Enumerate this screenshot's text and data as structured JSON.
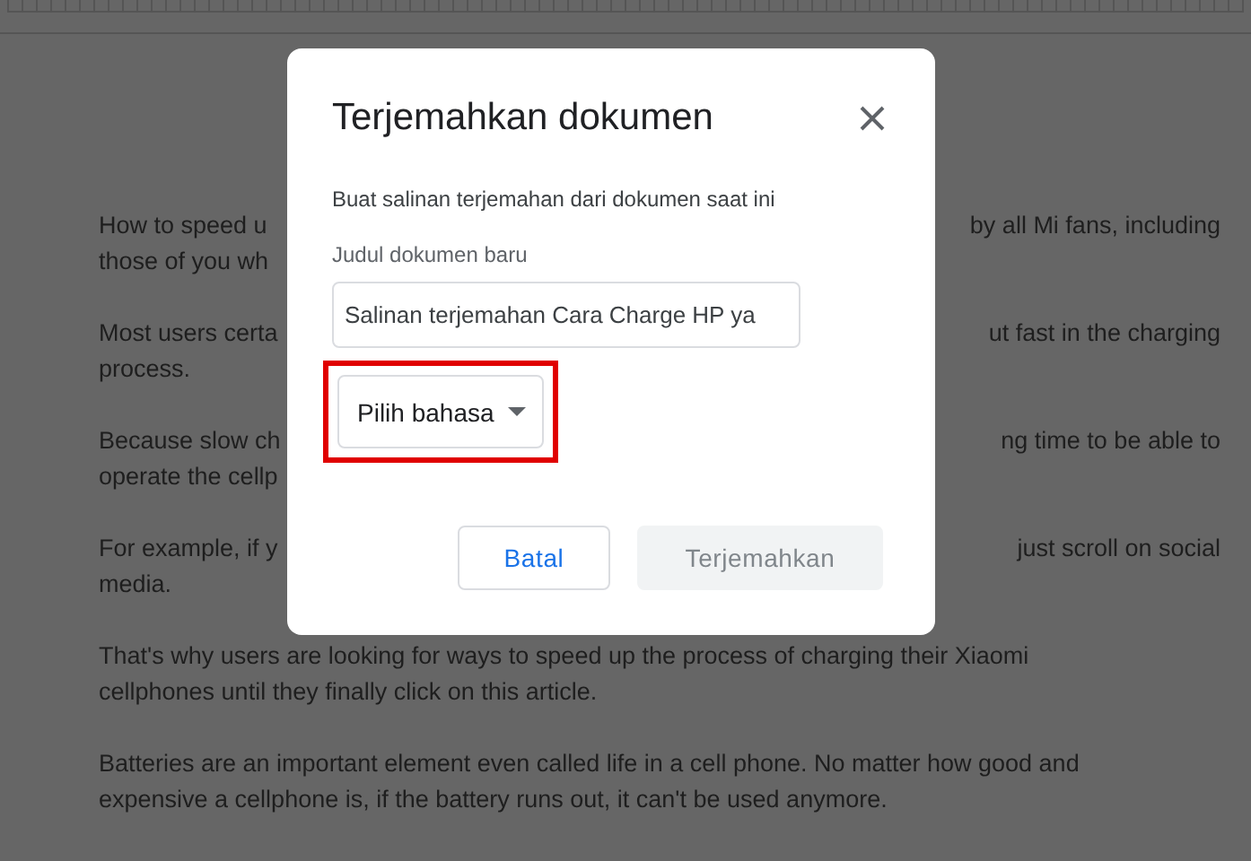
{
  "document": {
    "paragraphs": [
      {
        "lines": [
          {
            "left": "How to speed u",
            "right": "by all Mi fans, including"
          },
          {
            "left": "those of you wh"
          }
        ]
      },
      {
        "lines": [
          {
            "left": "Most users certa",
            "right": "ut fast in the charging"
          },
          {
            "left": "process."
          }
        ]
      },
      {
        "lines": [
          {
            "left": "Because slow ch",
            "right": "ng time to be able to"
          },
          {
            "left": "operate the cellp"
          }
        ]
      },
      {
        "lines": [
          {
            "left": "For example, if y",
            "right": "just scroll on social"
          },
          {
            "left": "media."
          }
        ]
      },
      {
        "lines": [
          {
            "left": "That's why users are looking for ways to speed up the process of charging their Xiaomi"
          },
          {
            "left": "cellphones until they finally click on this article."
          }
        ]
      },
      {
        "lines": [
          {
            "left": "Batteries are an important element even called life in a cell phone. No matter how good and"
          },
          {
            "left": "expensive a cellphone is, if the battery runs out, it can't be used anymore."
          }
        ]
      }
    ]
  },
  "dialog": {
    "title": "Terjemahkan dokumen",
    "subtitle": "Buat salinan terjemahan dari dokumen saat ini",
    "field": {
      "label": "Judul dokumen baru",
      "value": "Salinan terjemahan Cara Charge HP ya"
    },
    "language_select": {
      "label": "Pilih bahasa",
      "highlighted": true
    },
    "buttons": [
      {
        "label": "Batal",
        "kind": "secondary",
        "disabled": false
      },
      {
        "label": "Terjemahkan",
        "kind": "primary",
        "disabled": true
      }
    ]
  }
}
